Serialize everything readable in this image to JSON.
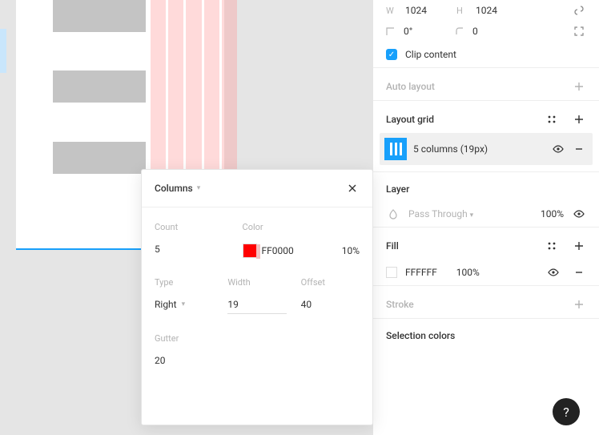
{
  "transform": {
    "w_label": "W",
    "w": "1024",
    "h_label": "H",
    "h": "1024",
    "rotation": "0°",
    "corner": "0",
    "clip_label": "Clip content"
  },
  "autolayout": {
    "title": "Auto layout"
  },
  "layoutgrid": {
    "title": "Layout grid",
    "item_label": "5 columns (19px)"
  },
  "layer": {
    "title": "Layer",
    "blend": "Pass Through",
    "opacity": "100%"
  },
  "fill": {
    "title": "Fill",
    "hex": "FFFFFF",
    "opacity": "100%"
  },
  "stroke": {
    "title": "Stroke"
  },
  "selection_colors": {
    "title": "Selection colors"
  },
  "popover": {
    "title": "Columns",
    "count_label": "Count",
    "count": "5",
    "color_label": "Color",
    "color_hex": "FF0000",
    "color_opacity": "10%",
    "type_label": "Type",
    "type": "Right",
    "width_label": "Width",
    "width": "19",
    "offset_label": "Offset",
    "offset": "40",
    "gutter_label": "Gutter",
    "gutter": "20"
  },
  "help": "?"
}
